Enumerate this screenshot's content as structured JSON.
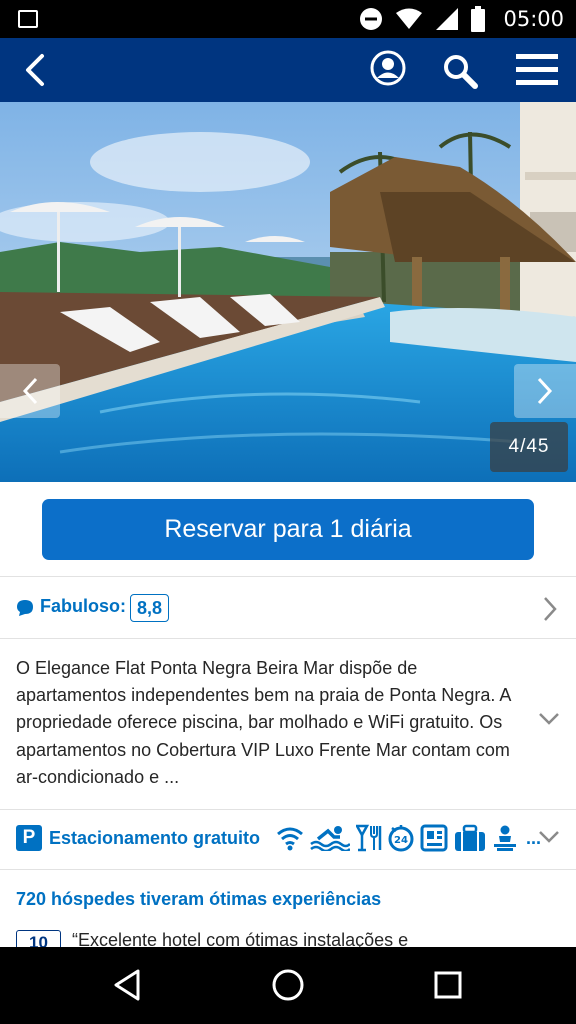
{
  "status_bar": {
    "time": "05:00"
  },
  "gallery": {
    "counter": "4/45"
  },
  "booking": {
    "reserve_label": "Reservar para 1 diária"
  },
  "rating": {
    "label": "Fabuloso:",
    "score": "8,8"
  },
  "description": {
    "text": "O Elegance Flat Ponta Negra Beira Mar dispõe de apartamentos independentes bem na praia de Ponta Negra. A propriedade oferece piscina, bar molhado e WiFi gratuito. Os apartamentos no Cobertura VIP Luxo Frente Mar contam com ar-condicionado e ..."
  },
  "facilities": {
    "parking_badge": "P",
    "label": "Estacionamento gratuito",
    "icons": [
      "wifi-icon",
      "swimming-pool-icon",
      "restaurant-bar-icon",
      "24h-reception-icon",
      "safe-icon",
      "luggage-icon",
      "room-service-icon"
    ],
    "more": "..."
  },
  "reviews": {
    "title": "720 hóspedes tiveram ótimas experiências",
    "first_score": "10",
    "first_quote": "“Excelente hotel com ótimas instalações e"
  },
  "colors": {
    "brand_dark": "#003580",
    "brand_blue": "#0071c2",
    "button_blue": "#0c6fc9"
  }
}
